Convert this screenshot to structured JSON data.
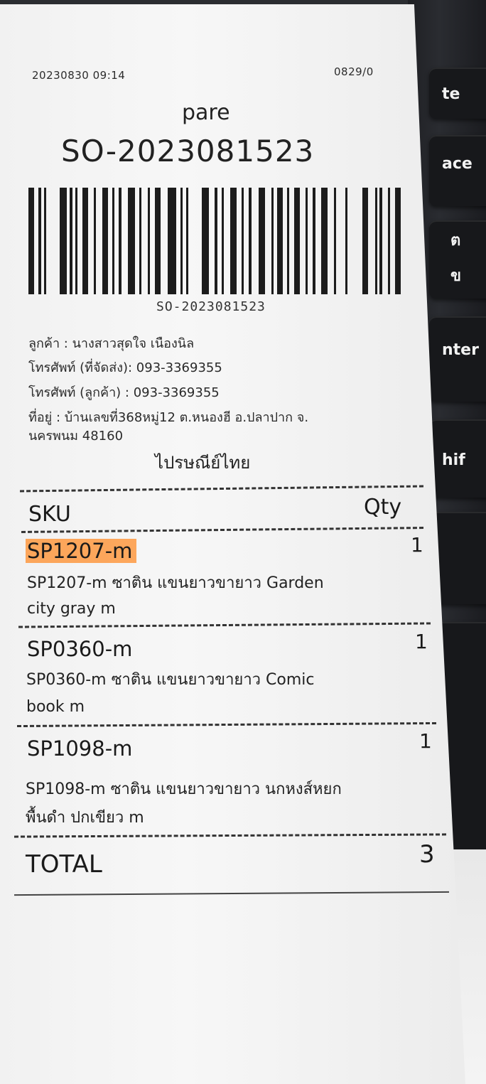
{
  "receipt": {
    "datetime": "20230830 09:14",
    "ref": "0829/0",
    "shop": "pare",
    "order_no": "SO-2023081523",
    "barcode_text": "SO-2023081523",
    "customer": "ลูกค้า : นางสาวสุดใจ เนืองนิล",
    "phone_ship": "โทรศัพท์ (ที่จัดส่ง): 093-3369355",
    "phone_customer": "โทรศัพท์ (ลูกค้า) : 093-3369355",
    "address_line1": "ที่อยู่ : บ้านเลขที่368หมู่12 ต.หนองฮี อ.ปลาปาก จ.",
    "address_line2": "นครพนม 48160",
    "carrier": "ไปรษณีย์ไทย",
    "sku_header": "SKU",
    "qty_header": "Qty",
    "items": [
      {
        "sku": "SP1207-m",
        "qty": "1",
        "desc1": "SP1207-m ซาติน แขนยาวขายาว Garden",
        "desc2": "city gray m"
      },
      {
        "sku": "SP0360-m",
        "qty": "1",
        "desc1": "SP0360-m ซาติน แขนยาวขายาว Comic",
        "desc2": "book m"
      },
      {
        "sku": "SP1098-m",
        "qty": "1",
        "desc1": "SP1098-m ซาติน แขนยาวขายาว นกหงส์หยก",
        "desc2": "พื้นดำ ปกเขียว m"
      }
    ],
    "total_label": "TOTAL",
    "total_value": "3"
  },
  "keyboard": {
    "keys": [
      "te",
      "ace",
      "ต",
      "ข",
      "nter",
      "hif"
    ]
  },
  "colors": {
    "highlight": "#ff8c28",
    "paper": "#f4f4f4",
    "keyboard": "#17181b"
  }
}
